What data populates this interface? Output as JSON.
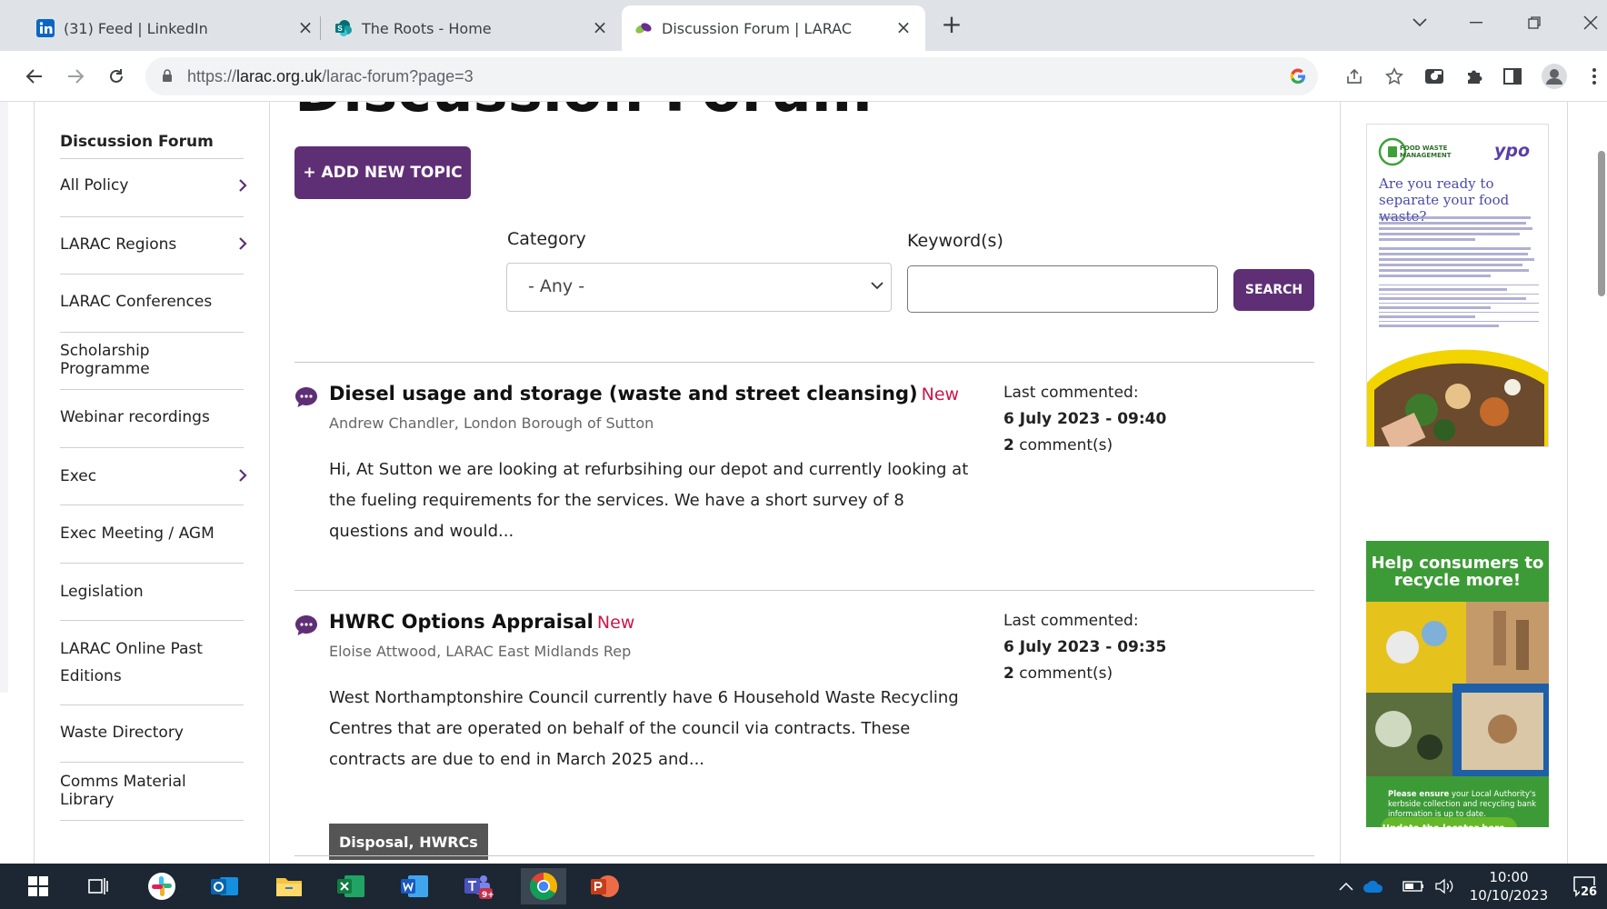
{
  "browser": {
    "tabs": [
      {
        "label": "(31) Feed | LinkedIn",
        "favicon": "linkedin-icon",
        "active": false
      },
      {
        "label": "The Roots - Home",
        "favicon": "sharepoint-icon",
        "active": false
      },
      {
        "label": "Discussion Forum | LARAC",
        "favicon": "larac-icon",
        "active": true
      }
    ],
    "new_tab": "+",
    "url_scheme": "https://",
    "url_host": "larac.org.uk",
    "url_path": "/larac-forum?page=3"
  },
  "sidebar": {
    "items": [
      {
        "label": "Discussion Forum",
        "bold": true,
        "chevron": false
      },
      {
        "label": "All Policy",
        "chevron": true
      },
      {
        "label": "LARAC Regions",
        "chevron": true
      },
      {
        "label": "LARAC Conferences",
        "chevron": false
      },
      {
        "label": "Scholarship Programme",
        "chevron": false
      },
      {
        "label": "Webinar recordings",
        "chevron": false
      },
      {
        "label": "Exec",
        "chevron": true
      },
      {
        "label": "Exec Meeting / AGM",
        "chevron": false
      },
      {
        "label": "Legislation",
        "chevron": false
      },
      {
        "label": "LARAC Online Past Editions",
        "chevron": false
      },
      {
        "label": "Waste Directory",
        "chevron": false
      },
      {
        "label": "Comms Material Library",
        "chevron": false
      }
    ]
  },
  "main": {
    "heading": "Discussion Forum",
    "add_topic_label": "+ ADD NEW TOPIC",
    "filters": {
      "category_label": "Category",
      "category_value": "- Any -",
      "keyword_label": "Keyword(s)",
      "keyword_value": "",
      "search_label": "SEARCH"
    },
    "topics": [
      {
        "title": "Diesel usage and storage (waste and street cleansing)",
        "badge": "New",
        "author": "Andrew Chandler, London Borough of Sutton",
        "excerpt": "Hi, At Sutton we are looking at refurbsihing our depot and currently looking at the fueling requirements for the services. We have a short survey of 8 questions and would...",
        "last_commented_label": "Last commented:",
        "last_commented": "6 July 2023 - 09:40",
        "comment_count": "2",
        "comment_suffix": " comment(s)",
        "tag": ""
      },
      {
        "title": "HWRC Options Appraisal",
        "badge": "New",
        "author": "Eloise Attwood, LARAC East Midlands Rep",
        "excerpt": "West Northamptonshire Council currently have 6 Household Waste Recycling Centres that are operated on behalf of the council via contracts. These contracts are due to end in March 2025 and...",
        "last_commented_label": "Last commented:",
        "last_commented": "6 July 2023 - 09:35",
        "comment_count": "2",
        "comment_suffix": " comment(s)",
        "tag": "Disposal, HWRCs"
      }
    ]
  },
  "ads": {
    "ad1": {
      "logo_left": "FOOD WASTE MANAGEMENT",
      "logo_right": "ypo",
      "headline": "Are you ready to separate your food waste?"
    },
    "ad2": {
      "headline": "Help consumers to recycle more!",
      "body_bold": "Please ensure",
      "body": " your Local Authority's kerbside collection and recycling bank information is up to date.",
      "button": "Update the locator here..."
    }
  },
  "taskbar": {
    "time": "10:00",
    "date": "10/10/2023",
    "notifications": "26",
    "apps": [
      "windows-start-icon",
      "task-view-icon",
      "slack-icon",
      "outlook-icon",
      "file-explorer-icon",
      "excel-icon",
      "word-icon",
      "teams-icon",
      "chrome-icon",
      "powerpoint-icon"
    ],
    "teams_badge": "9+"
  },
  "colors": {
    "brand_purple": "#5f2f76",
    "new_badge": "#c9184a",
    "tag_bg": "#555555",
    "taskbar": "#1c2733"
  }
}
